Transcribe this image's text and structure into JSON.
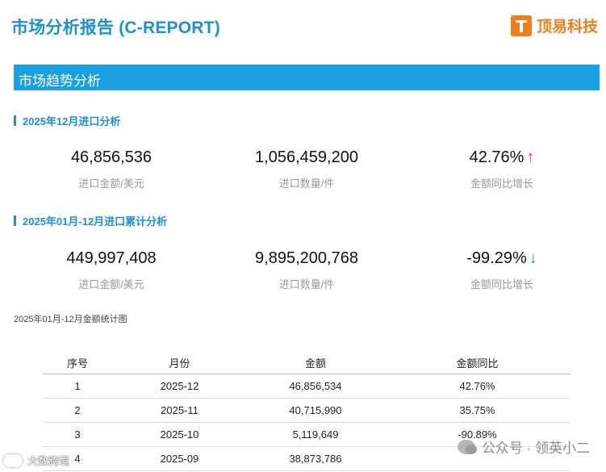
{
  "header": {
    "title": "市场分析报告 (C-REPORT)",
    "brand_name": "顶易科技"
  },
  "section": {
    "title": "市场趋势分析"
  },
  "monthly": {
    "title": "2025年12月进口分析",
    "stats": [
      {
        "value": "46,856,536",
        "label": "进口金额/美元"
      },
      {
        "value": "1,056,459,200",
        "label": "进口数量/件"
      },
      {
        "value": "42.76%",
        "label": "金额同比增长",
        "arrow": "↑",
        "trend": "up"
      }
    ]
  },
  "cumulative": {
    "title": "2025年01月-12月进口累计分析",
    "stats": [
      {
        "value": "449,997,408",
        "label": "进口金额/美元"
      },
      {
        "value": "9,895,200,768",
        "label": "进口数量/件"
      },
      {
        "value": "-99.29%",
        "label": "金额同比增长",
        "arrow": "↓",
        "trend": "down"
      }
    ]
  },
  "chart_caption": "2025年01月-12月金额统计图",
  "table": {
    "headers": [
      "序号",
      "月份",
      "金额",
      "金额同比"
    ],
    "rows": [
      [
        "1",
        "2025-12",
        "46,856,534",
        "42.76%"
      ],
      [
        "2",
        "2025-11",
        "40,715,990",
        "35.75%"
      ],
      [
        "3",
        "2025-10",
        "5,119,649",
        "-90.89%"
      ],
      [
        "4",
        "2025-09",
        "38,873,786",
        ""
      ]
    ]
  },
  "watermarks": {
    "left": "大数跨境",
    "right": "公众号 · 领英小二"
  },
  "colors": {
    "accent": "#1a9fe0",
    "brand": "#f07d1f",
    "up": "#e0302c",
    "down": "#2aa84a"
  }
}
